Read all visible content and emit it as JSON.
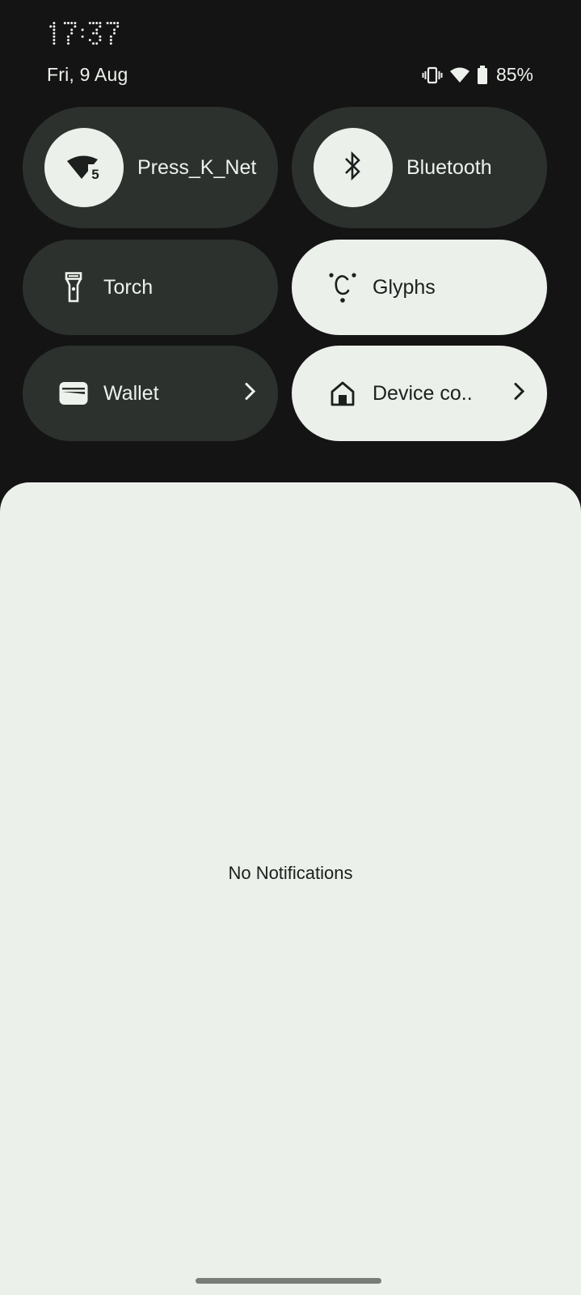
{
  "status_bar": {
    "time": "17:37",
    "date": "Fri, 9 Aug",
    "icons": [
      "vibrate-icon",
      "wifi-icon",
      "battery-icon"
    ],
    "battery_percent": "85%"
  },
  "quick_settings": {
    "tiles": [
      {
        "id": "wifi",
        "label": "Press_K_Net",
        "icon": "wifi-5-icon",
        "badge": "5",
        "state": "off"
      },
      {
        "id": "bluetooth",
        "label": "Bluetooth",
        "icon": "bluetooth-icon",
        "state": "off"
      },
      {
        "id": "torch",
        "label": "Torch",
        "icon": "torch-icon",
        "state": "off"
      },
      {
        "id": "glyphs",
        "label": "Glyphs",
        "icon": "glyphs-icon",
        "state": "on"
      },
      {
        "id": "wallet",
        "label": "Wallet",
        "icon": "wallet-icon",
        "state": "off",
        "has_chevron": true
      },
      {
        "id": "device_controls",
        "label": "Device co..",
        "icon": "home-icon",
        "state": "on",
        "has_chevron": true
      }
    ]
  },
  "notifications": {
    "empty_text": "No Notifications"
  },
  "colors": {
    "background": "#141414",
    "tile_off": "#2c312e",
    "tile_on": "#ebf0ea",
    "text_light": "#eef2ec",
    "text_dark": "#1c1f1d",
    "nav_handle": "#797c78"
  }
}
